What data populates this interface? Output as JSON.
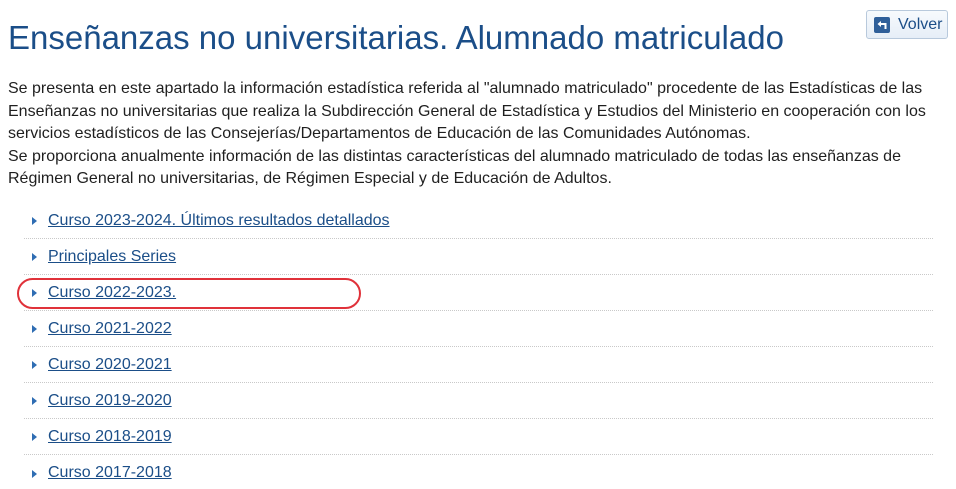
{
  "header": {
    "title": "Enseñanzas no universitarias. Alumnado matriculado",
    "back_button": {
      "label": "Volver",
      "icon": "back-arrow-icon"
    }
  },
  "intro": {
    "paragraph_1": "Se presenta en este apartado la información estadística referida al \"alumnado matriculado\" procedente de las Estadísticas de las Enseñanzas no universitarias que realiza la Subdirección General de Estadística y Estudios del Ministerio en cooperación con los servicios estadísticos de las Consejerías/Departamentos de Educación de las Comunidades Autónomas.",
    "paragraph_2": "Se proporciona anualmente información de las distintas características del alumnado matriculado de todas las enseñanzas de Régimen General no universitarias, de Régimen Especial y de Educación de Adultos."
  },
  "courses": [
    {
      "label": "Curso 2023-2024. Últimos resultados detallados"
    },
    {
      "label": "Principales Series"
    },
    {
      "label": "Curso 2022-2023."
    },
    {
      "label": "Curso 2021-2022"
    },
    {
      "label": "Curso 2020-2021"
    },
    {
      "label": "Curso 2019-2020"
    },
    {
      "label": "Curso 2018-2019"
    },
    {
      "label": "Curso 2017-2018"
    }
  ],
  "colors": {
    "heading": "#1b4e88",
    "link": "#1b4e88",
    "body_text": "#1f1f1f",
    "bullet": "#2f6db3",
    "highlight": "#e0323a"
  }
}
